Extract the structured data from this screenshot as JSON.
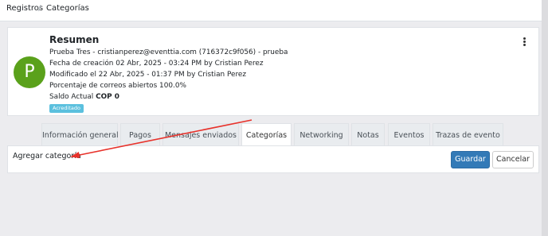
{
  "breadcrumb": {
    "item1": "Registros",
    "separator": "/",
    "item2": "Categorías"
  },
  "summary": {
    "title": "Resumen",
    "avatar_letter": "P",
    "name_line": "Prueba Tres - cristianperez@eventtia.com (716372c9f056) - prueba",
    "created_line": "Fecha de creación 02 Abr, 2025 - 03:24 PM by Cristian Perez",
    "modified_line": "Modificado el 22 Abr, 2025 - 01:37 PM by Cristian Perez",
    "open_rate_line": "Porcentaje de correos abiertos 100.0%",
    "balance_label": "Saldo Actual",
    "balance_value": "COP 0",
    "badge": "Acreditado",
    "menu_icon": "kebab-vertical-icon"
  },
  "tabs": [
    {
      "label": "Información general"
    },
    {
      "label": "Pagos"
    },
    {
      "label": "Mensajes enviados"
    },
    {
      "label": "Categorías",
      "active": true
    },
    {
      "label": "Networking"
    },
    {
      "label": "Notas"
    },
    {
      "label": "Eventos"
    },
    {
      "label": "Trazas de evento"
    }
  ],
  "panel": {
    "label": "Agregar categoría",
    "save_label": "Guardar",
    "cancel_label": "Cancelar"
  },
  "colors": {
    "avatar": "#5aa11b",
    "primary_button": "#337ab7",
    "badge": "#5bc0de",
    "annotation_arrow": "#e8322b"
  }
}
